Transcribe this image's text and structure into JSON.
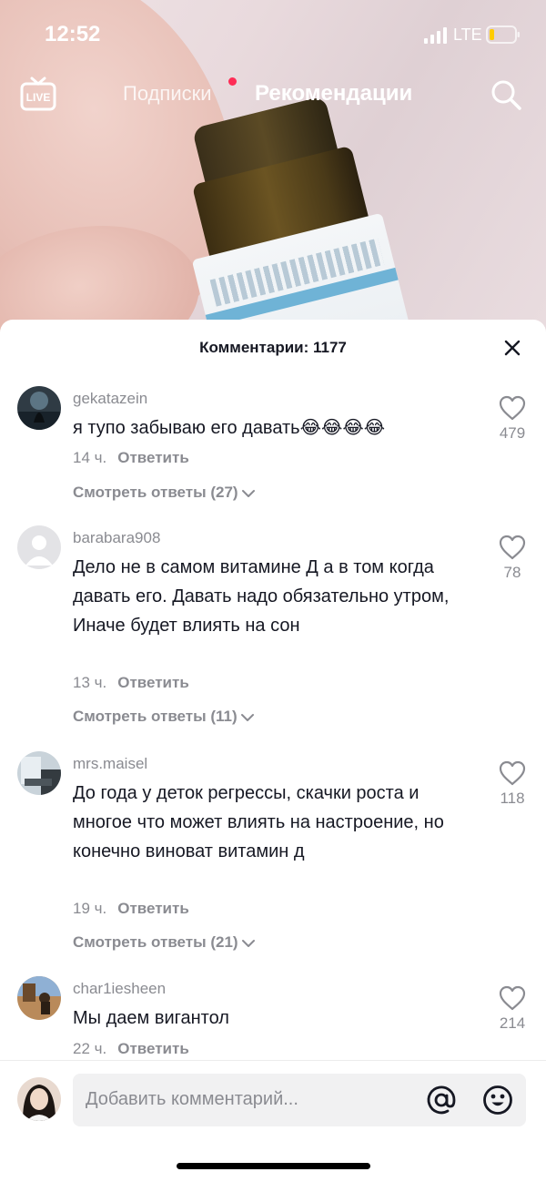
{
  "status_bar": {
    "time": "12:52",
    "network": "LTE"
  },
  "top_nav": {
    "live_label": "LIVE",
    "tab_following": "Подписки",
    "tab_for_you": "Рекомендации"
  },
  "comments_panel": {
    "title": "Комментарии: 1177",
    "comments": [
      {
        "username": "gekatazein",
        "text": "я тупо забываю его давать😂😂😂😂",
        "time": "14 ч.",
        "reply_label": "Ответить",
        "likes": "479",
        "view_replies": "Смотреть ответы (27)"
      },
      {
        "username": "barabara908",
        "text": "Дело не в самом витамине Д а в том когда давать его. Давать надо обязательно утром, Иначе будет влиять на сон",
        "time": "13 ч.",
        "reply_label": "Ответить",
        "likes": "78",
        "view_replies": "Смотреть ответы (11)"
      },
      {
        "username": "mrs.maisel",
        "text": "До года у деток регрессы, скачки роста и многое что может влиять на настроение, но конечно виноват витамин д",
        "time": "19 ч.",
        "reply_label": "Ответить",
        "likes": "118",
        "view_replies": "Смотреть ответы (21)"
      },
      {
        "username": "char1iesheen",
        "text": "Мы даем вигантол",
        "time": "22 ч.",
        "reply_label": "Ответить",
        "likes": "214"
      }
    ]
  },
  "input_bar": {
    "placeholder": "Добавить комментарий..."
  },
  "colors": {
    "accent": "#fe2c55",
    "text_primary": "#161823",
    "text_secondary": "#8a8b91"
  }
}
